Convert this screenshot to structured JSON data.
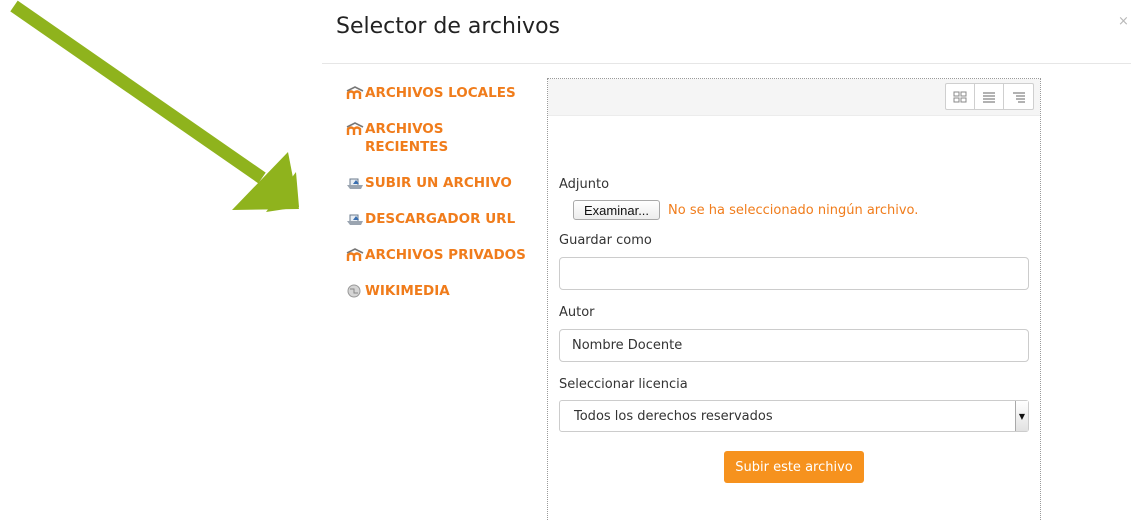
{
  "dialog": {
    "title": "Selector de archivos",
    "close_label": "×"
  },
  "repositories": [
    {
      "label": "ARCHIVOS LOCALES",
      "icon": "moodle-icon"
    },
    {
      "label": "ARCHIVOS RECIENTES",
      "icon": "moodle-icon"
    },
    {
      "label": "SUBIR UN ARCHIVO",
      "icon": "upload-icon"
    },
    {
      "label": "DESCARGADOR URL",
      "icon": "upload-icon"
    },
    {
      "label": "ARCHIVOS PRIVADOS",
      "icon": "moodle-icon"
    },
    {
      "label": "WIKIMEDIA",
      "icon": "wikimedia-globe-icon"
    }
  ],
  "toolbar": {
    "view_modes": [
      "icons-view-icon",
      "list-view-icon",
      "tree-view-icon"
    ]
  },
  "form": {
    "attachment_label": "Adjunto",
    "browse_button": "Examinar...",
    "file_status": "No se ha seleccionado ningún archivo.",
    "save_as_label": "Guardar como",
    "save_as_value": "",
    "author_label": "Autor",
    "author_value": "Nombre Docente",
    "license_label": "Seleccionar licencia",
    "license_value": "Todos los derechos reservados",
    "submit_label": "Subir este archivo"
  },
  "colors": {
    "accent": "#f07c1b",
    "button": "#f6921e",
    "arrow": "#8fb31d"
  }
}
